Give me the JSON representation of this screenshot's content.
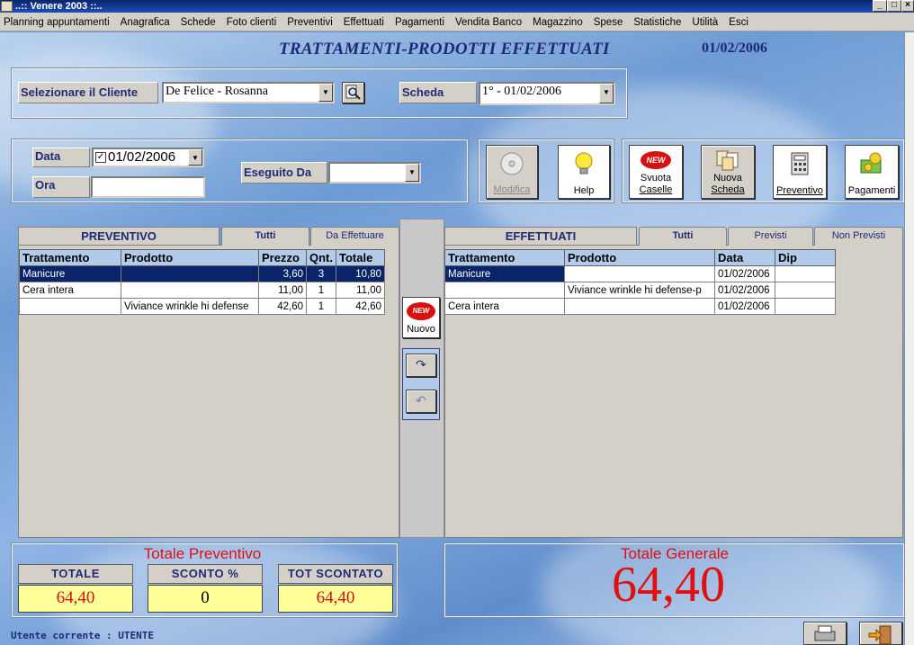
{
  "window": {
    "title": "..:: Venere 2003 ::..",
    "min": "_",
    "max": "□",
    "close": "×"
  },
  "menu": [
    "Planning appuntamenti",
    "Anagrafica",
    "Schede",
    "Foto clienti",
    "Preventivi",
    "Effettuati",
    "Pagamenti",
    "Vendita Banco",
    "Magazzino",
    "Spese",
    "Statistiche",
    "Utilità",
    "Esci"
  ],
  "header": {
    "title": "TRATTAMENTI-PRODOTTI EFFETTUATI",
    "date": "01/02/2006"
  },
  "client": {
    "label": "Selezionare il Cliente",
    "value": "De Felice  -  Rosanna",
    "scheda_label": "Scheda",
    "scheda_value": "1° - 01/02/2006"
  },
  "form": {
    "data_label": "Data",
    "data_value": "01/02/2006",
    "ora_label": "Ora",
    "eseguito_label": "Eseguito Da",
    "eseguito_value": ""
  },
  "toolbar": {
    "modifica": "Modifica",
    "help": "Help",
    "svuota_1": "Svuota",
    "svuota_2": "Caselle",
    "nuova_1": "Nuova",
    "nuova_2": "Scheda",
    "preventivo": "Preventivo",
    "pagamenti": "Pagamenti",
    "new_badge": "NEW"
  },
  "preventivo": {
    "title": "PREVENTIVO",
    "tabs": [
      "Tutti",
      "Da Effettuare"
    ],
    "columns": [
      "Trattamento",
      "Prodotto",
      "Prezzo",
      "Qnt.",
      "Totale"
    ],
    "rows": [
      [
        "Manicure",
        "",
        "3,60",
        "3",
        "10,80"
      ],
      [
        "Cera intera",
        "",
        "11,00",
        "1",
        "11,00"
      ],
      [
        "",
        "Viviance wrinkle hi defense",
        "42,60",
        "1",
        "42,60"
      ]
    ]
  },
  "effettuati": {
    "title": "EFFETTUATI",
    "tabs": [
      "Tutti",
      "Previsti",
      "Non Previsti"
    ],
    "columns": [
      "Trattamento",
      "Prodotto",
      "Data",
      "Dip"
    ],
    "rows": [
      [
        "Manicure",
        "",
        "01/02/2006",
        ""
      ],
      [
        "",
        "Viviance wrinkle hi defense-p",
        "01/02/2006",
        ""
      ],
      [
        "Cera intera",
        "",
        "01/02/2006",
        ""
      ]
    ]
  },
  "middle": {
    "nuovo": "Nuovo",
    "new_badge": "NEW"
  },
  "totals": {
    "preventivo_title": "Totale Preventivo",
    "totale_label": "TOTALE",
    "totale_value": "64,40",
    "sconto_label": "SCONTO %",
    "sconto_value": "0",
    "scontato_label": "TOT SCONTATO",
    "scontato_value": "64,40",
    "generale_title": "Totale Generale",
    "generale_value": "64,40"
  },
  "status": {
    "user": "Utente corrente : UTENTE"
  }
}
